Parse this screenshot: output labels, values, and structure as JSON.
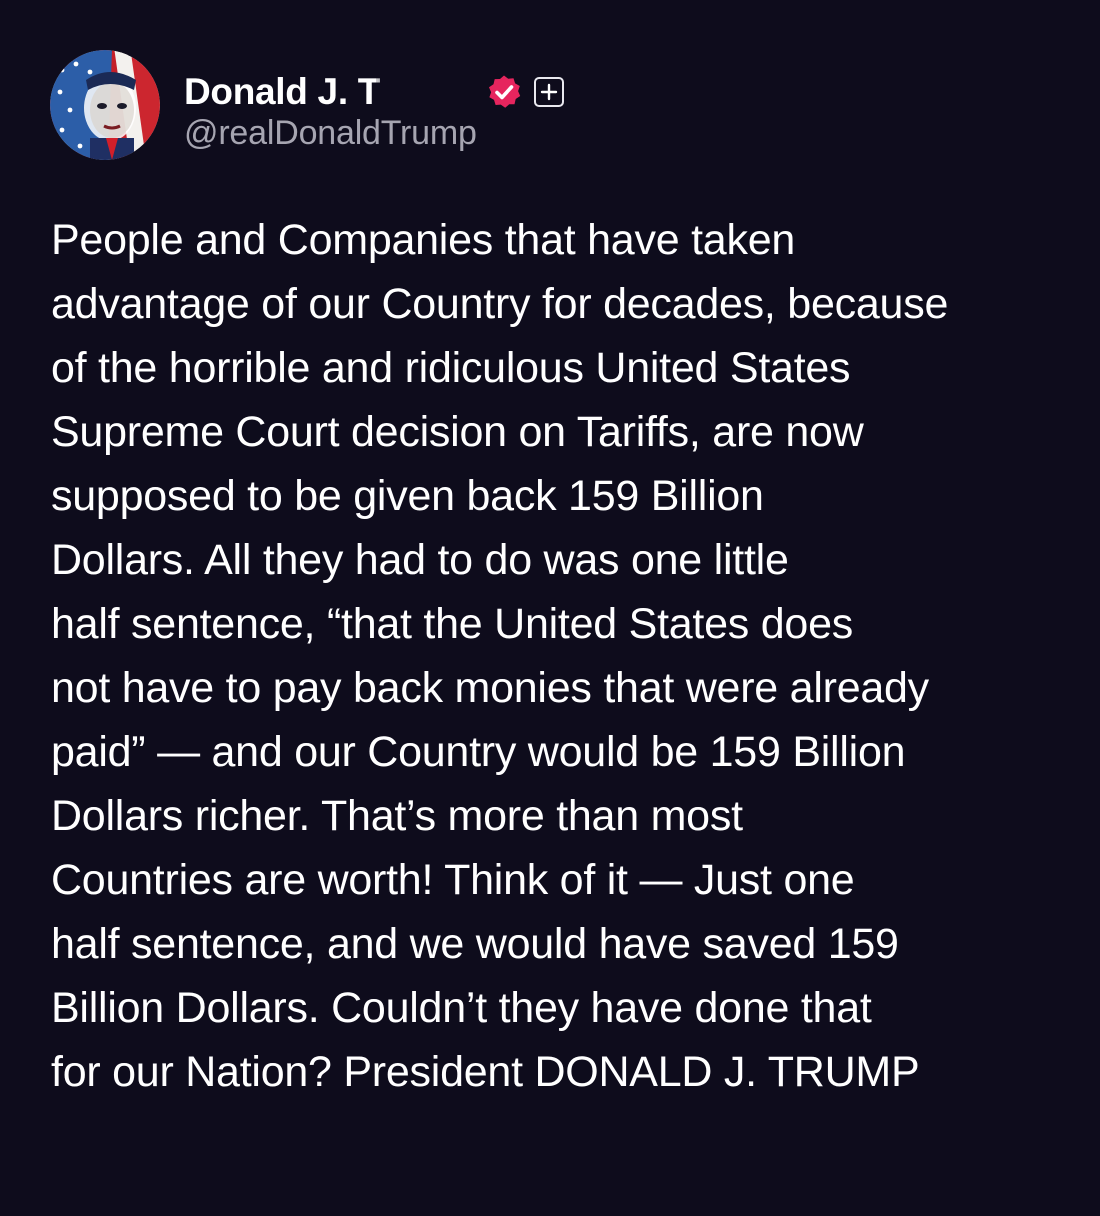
{
  "author": {
    "display_name": "Donald J. T",
    "handle": "@realDonaldTrump",
    "avatar_icon": "flag-portrait-avatar",
    "verified_icon": "verified-badge-icon",
    "verified_color": "#e6255e",
    "follow_icon": "plus-icon"
  },
  "post": {
    "lines": [
      "People and Companies that have taken",
      "advantage of our Country for decades, because",
      "of the horrible and ridiculous United States",
      "Supreme Court decision on Tariffs, are now",
      "supposed to be given back 159 Billion",
      "Dollars. All they had to do was one little",
      "half sentence, “that the United States does",
      "not have to pay back monies that were already",
      "paid” — and our Country would be 159 Billion",
      "Dollars richer. That’s more than most",
      "Countries are worth! Think of it — Just one",
      "half sentence, and we would have saved 159",
      "Billion Dollars. Couldn’t they have done that",
      "for our Nation? President DONALD J. TRUMP"
    ]
  },
  "colors": {
    "background": "#0e0c1c",
    "text": "#ffffff",
    "handle": "#a6a5b1"
  }
}
